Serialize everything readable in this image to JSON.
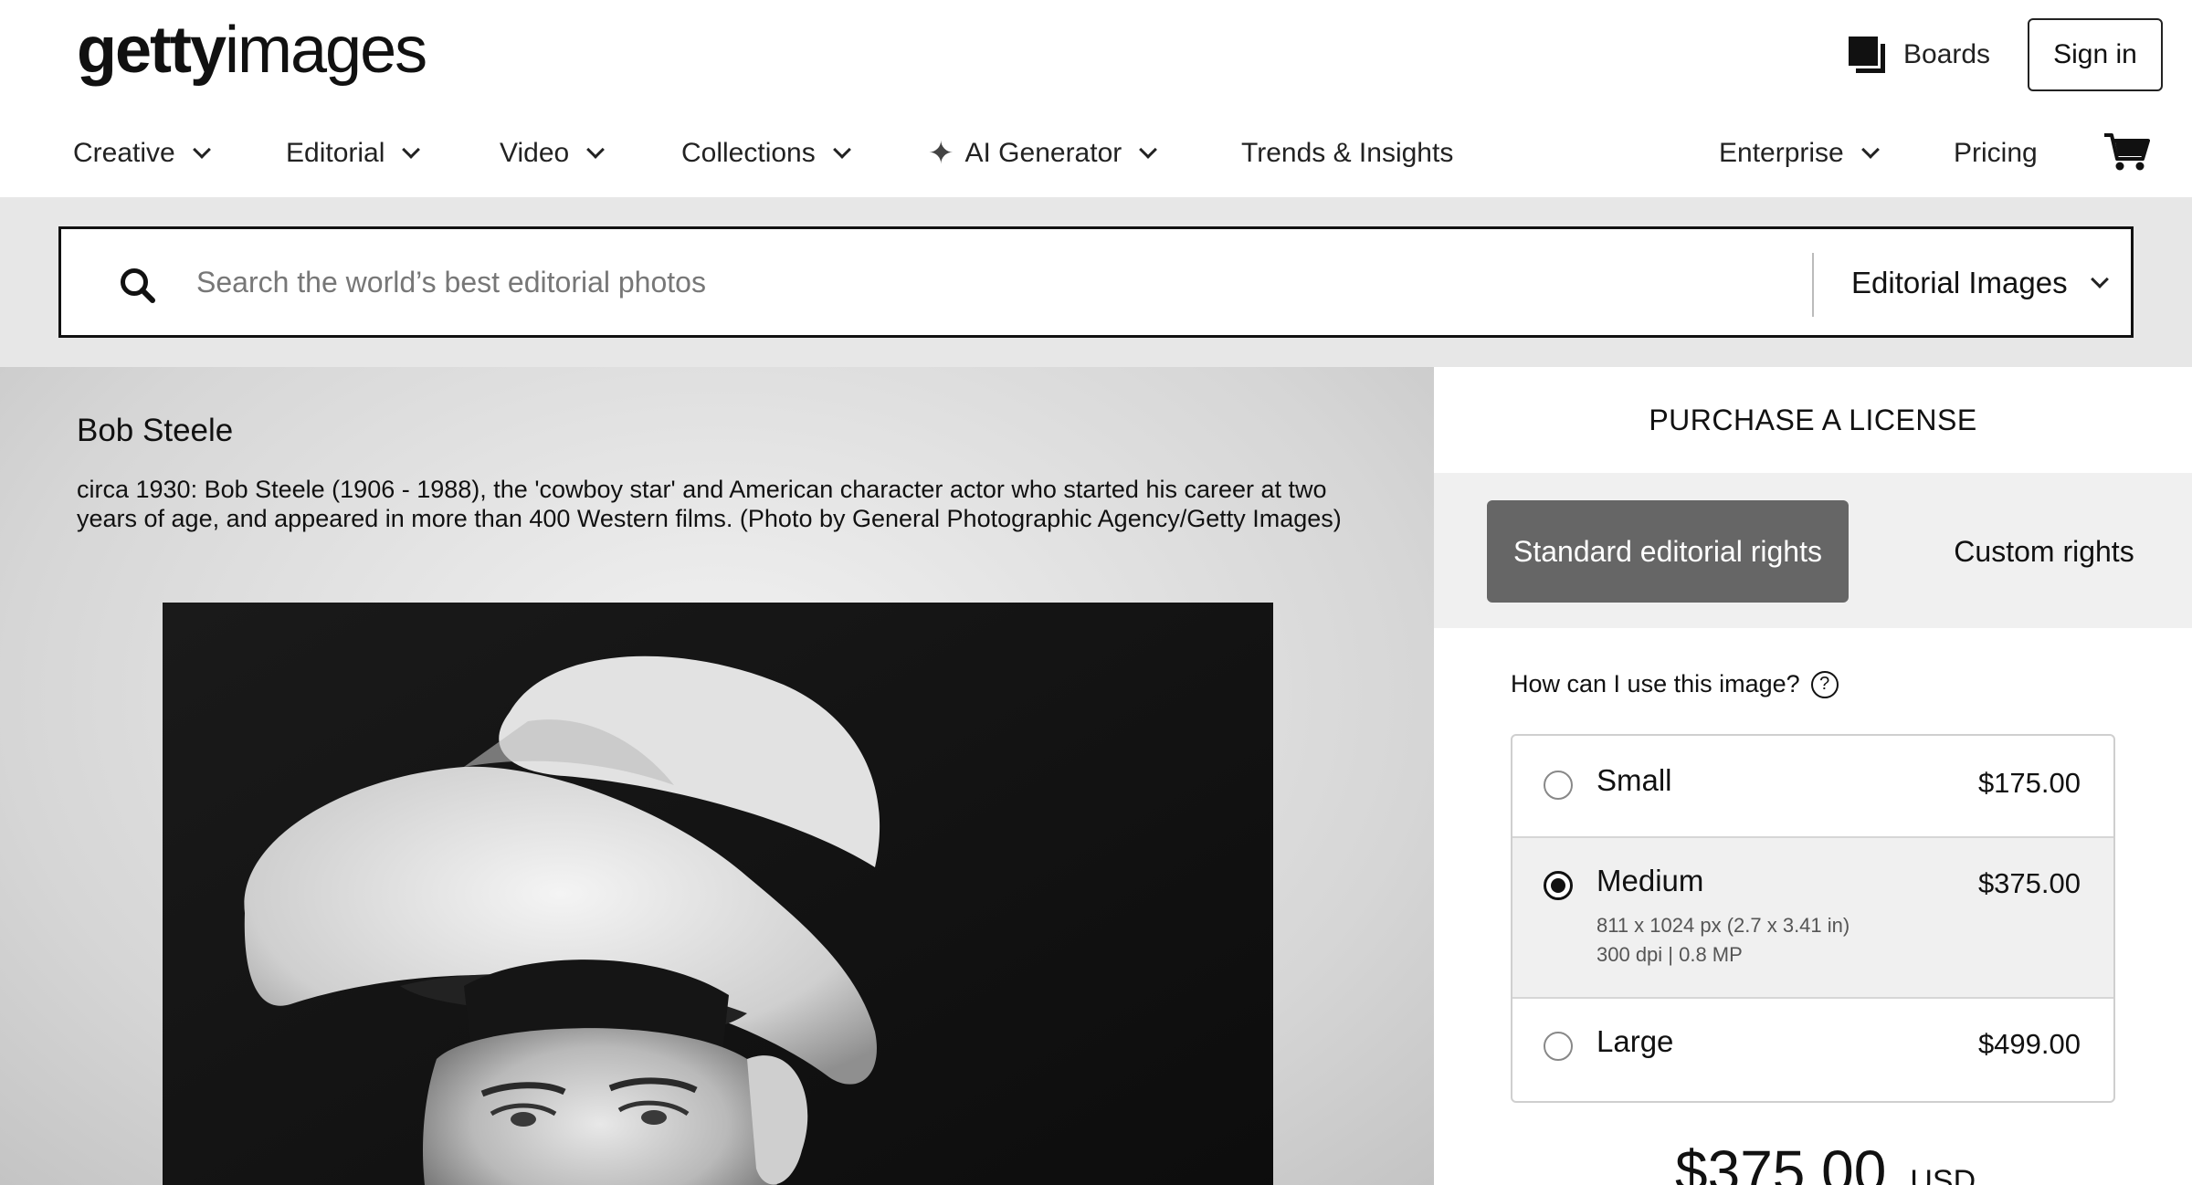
{
  "header": {
    "logo_bold": "getty",
    "logo_light": "images",
    "boards_label": "Boards",
    "signin_label": "Sign in"
  },
  "nav": {
    "creative": "Creative",
    "editorial": "Editorial",
    "video": "Video",
    "collections": "Collections",
    "ai_generator": "AI Generator",
    "trends": "Trends & Insights",
    "enterprise": "Enterprise",
    "pricing": "Pricing"
  },
  "search": {
    "placeholder": "Search the world’s best editorial photos",
    "value": "",
    "type_selected": "Editorial Images"
  },
  "image": {
    "title": "Bob Steele",
    "caption": "circa 1930: Bob Steele (1906 - 1988), the 'cowboy star' and American character actor who started his career at two years of age, and appeared in more than 400 Western films. (Photo by General Photographic Agency/Getty Images)"
  },
  "purchase": {
    "title": "PURCHASE A LICENSE",
    "rights_standard": "Standard editorial rights",
    "rights_custom": "Custom rights",
    "use_question": "How can I use this image?",
    "help_glyph": "?",
    "options": [
      {
        "label": "Small",
        "price": "$175.00",
        "selected": false
      },
      {
        "label": "Medium",
        "price": "$375.00",
        "selected": true,
        "detail_1": "811 x 1024 px (2.7 x 3.41 in)",
        "detail_2": "300 dpi | 0.8 MP"
      },
      {
        "label": "Large",
        "price": "$499.00",
        "selected": false
      }
    ],
    "total_price": "$375.00",
    "total_currency": "USD"
  },
  "icons": {
    "boards": "boards-icon",
    "search": "search-icon",
    "cart": "cart-icon",
    "sparkle": "sparkle-icon",
    "help": "help-icon",
    "chevron": "chevron-down-icon"
  },
  "colors": {
    "selected_rights_bg": "#666666",
    "search_band_bg": "#e7e7e7",
    "rights_band_bg": "#f0f0f0"
  }
}
